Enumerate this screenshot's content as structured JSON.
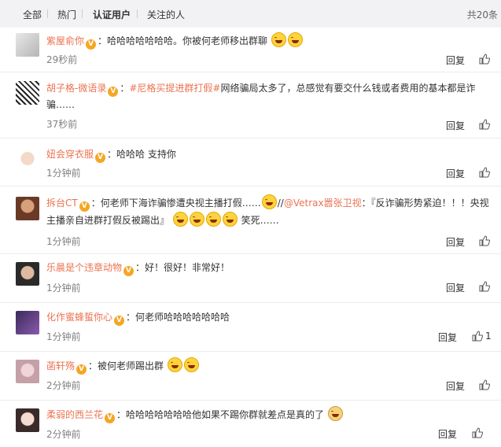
{
  "tabs": [
    "全部",
    "热门",
    "认证用户",
    "关注的人"
  ],
  "active_tab": "认证用户",
  "total": "共20条",
  "reply_label": "回复",
  "comments": [
    {
      "user": "紫屋俞你",
      "vip": "V",
      "sep": "：",
      "parts": [
        "哈哈哈哈哈哈哈。你被何老师移出群聊"
      ],
      "time": "29秒前",
      "likes": ""
    },
    {
      "user": "胡子格-微语录",
      "vip": "V",
      "sep": "：",
      "topic": "#尼格买提进群打假#",
      "parts": [
        "网络骗局太多了，总感觉有要交什么钱或者费用的基本都是诈骗……"
      ],
      "time": "37秒前",
      "likes": ""
    },
    {
      "user": "妞会穿衣服",
      "vip": "V",
      "sep": "：",
      "parts": [
        "哈哈哈 支持你"
      ],
      "time": "1分钟前",
      "likes": ""
    },
    {
      "user": "拆台CT",
      "vip": "V",
      "sep": "：",
      "parts": [
        "何老师下海诈骗惨遭央视主播打假……",
        "//",
        "@Vetrax嚣张卫视",
        "：『反诈骗形势紧迫！！！央视主播亲自进群打假反被踢出』",
        "笑死……"
      ],
      "time": "1分钟前",
      "likes": ""
    },
    {
      "user": "乐晨是个违章动物",
      "vip": "V",
      "sep": "：",
      "parts": [
        "好！很好！非常好！"
      ],
      "time": "1分钟前",
      "likes": ""
    },
    {
      "user": "化作蜜蜂蜇你心",
      "vip": "V",
      "sep": "：",
      "parts": [
        "何老师哈哈哈哈哈哈哈"
      ],
      "time": "1分钟前",
      "likes": "1"
    },
    {
      "user": "菡轩殇",
      "vip": "V",
      "sep": "：",
      "parts": [
        "被何老师踢出群"
      ],
      "time": "2分钟前",
      "likes": ""
    },
    {
      "user": "柔弱的西兰花",
      "vip": "V",
      "sep": "：",
      "parts": [
        "哈哈哈哈哈哈哈他如果不踢你群就差点是真的了"
      ],
      "time": "2分钟前",
      "likes": ""
    }
  ]
}
